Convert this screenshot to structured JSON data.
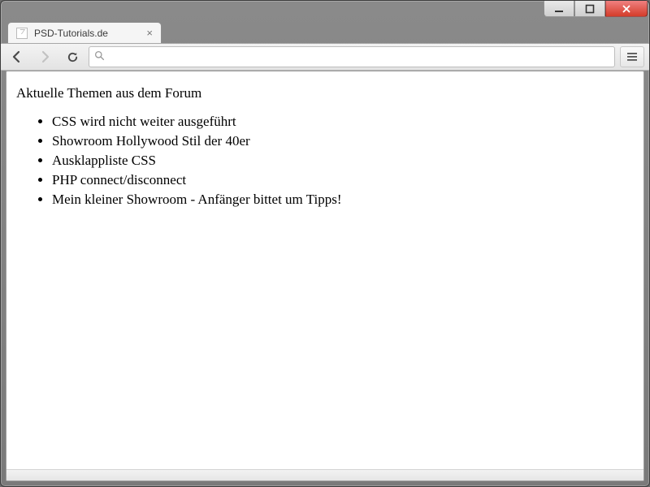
{
  "window": {
    "tab_title": "PSD-Tutorials.de"
  },
  "toolbar": {
    "url": ""
  },
  "page": {
    "heading": "Aktuelle Themen aus dem Forum",
    "items": [
      "CSS wird nicht weiter ausgeführt",
      "Showroom Hollywood Stil der 40er",
      "Ausklappliste CSS",
      "PHP connect/disconnect",
      "Mein kleiner Showroom - Anfänger bittet um Tipps!"
    ]
  }
}
